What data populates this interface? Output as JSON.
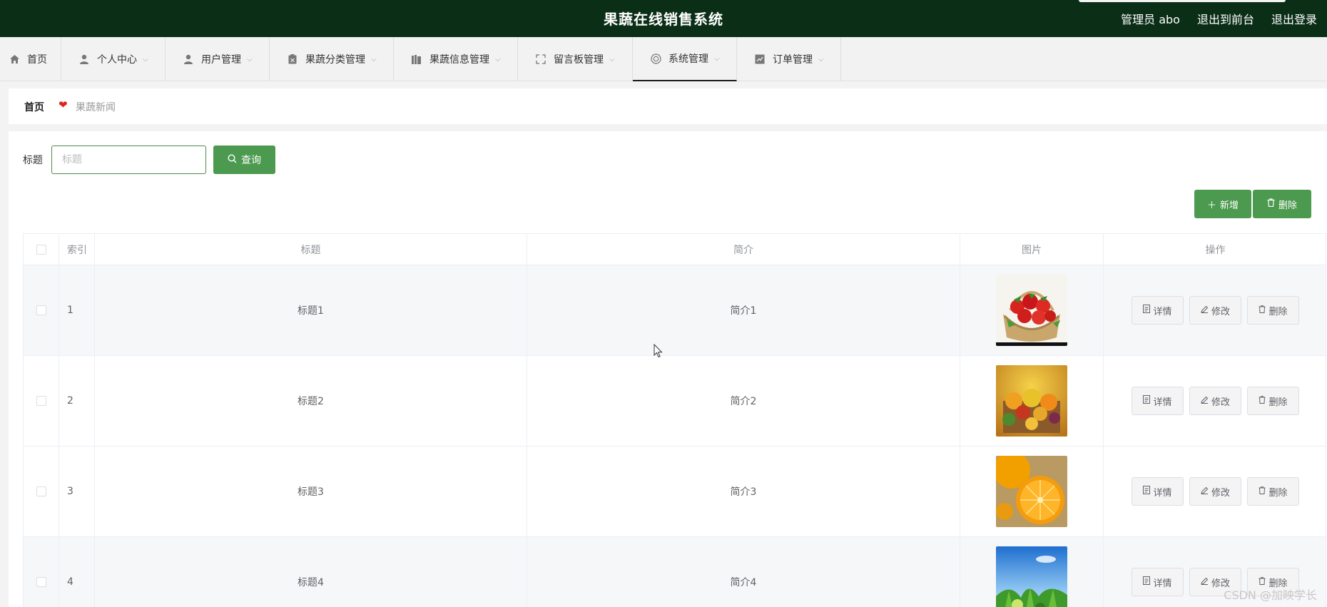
{
  "header": {
    "title": "果蔬在线销售系统",
    "admin": "管理员 abo",
    "to_front": "退出到前台",
    "logout": "退出登录"
  },
  "nav": [
    {
      "label": "首页",
      "icon": "home-icon"
    },
    {
      "label": "个人中心",
      "icon": "user-icon"
    },
    {
      "label": "用户管理",
      "icon": "user-icon"
    },
    {
      "label": "果蔬分类管理",
      "icon": "clipboard-icon"
    },
    {
      "label": "果蔬信息管理",
      "icon": "book-icon"
    },
    {
      "label": "留言板管理",
      "icon": "fullscreen-icon"
    },
    {
      "label": "系统管理",
      "icon": "settings-circle-icon",
      "active": true
    },
    {
      "label": "订单管理",
      "icon": "chart-icon"
    }
  ],
  "breadcrumb": {
    "home": "首页",
    "current": "果蔬新闻"
  },
  "search": {
    "label": "标题",
    "placeholder": "标题",
    "button": "查询"
  },
  "actions": {
    "add": "新增",
    "delete": "删除"
  },
  "table": {
    "columns": {
      "index": "索引",
      "title": "标题",
      "desc": "简介",
      "image": "图片",
      "ops": "操作"
    },
    "rows": [
      {
        "index": "1",
        "title": "标题1",
        "desc": "简介1",
        "image": "strawberry-basket-photo"
      },
      {
        "index": "2",
        "title": "标题2",
        "desc": "简介2",
        "image": "mixed-fruit-photo"
      },
      {
        "index": "3",
        "title": "标题3",
        "desc": "简介3",
        "image": "orange-photo"
      },
      {
        "index": "4",
        "title": "标题4",
        "desc": "简介4",
        "image": "vegetables-sky-photo"
      }
    ],
    "row_buttons": {
      "detail": "详情",
      "edit": "修改",
      "delete": "删除"
    }
  },
  "watermark": "CSDN @加映学长"
}
